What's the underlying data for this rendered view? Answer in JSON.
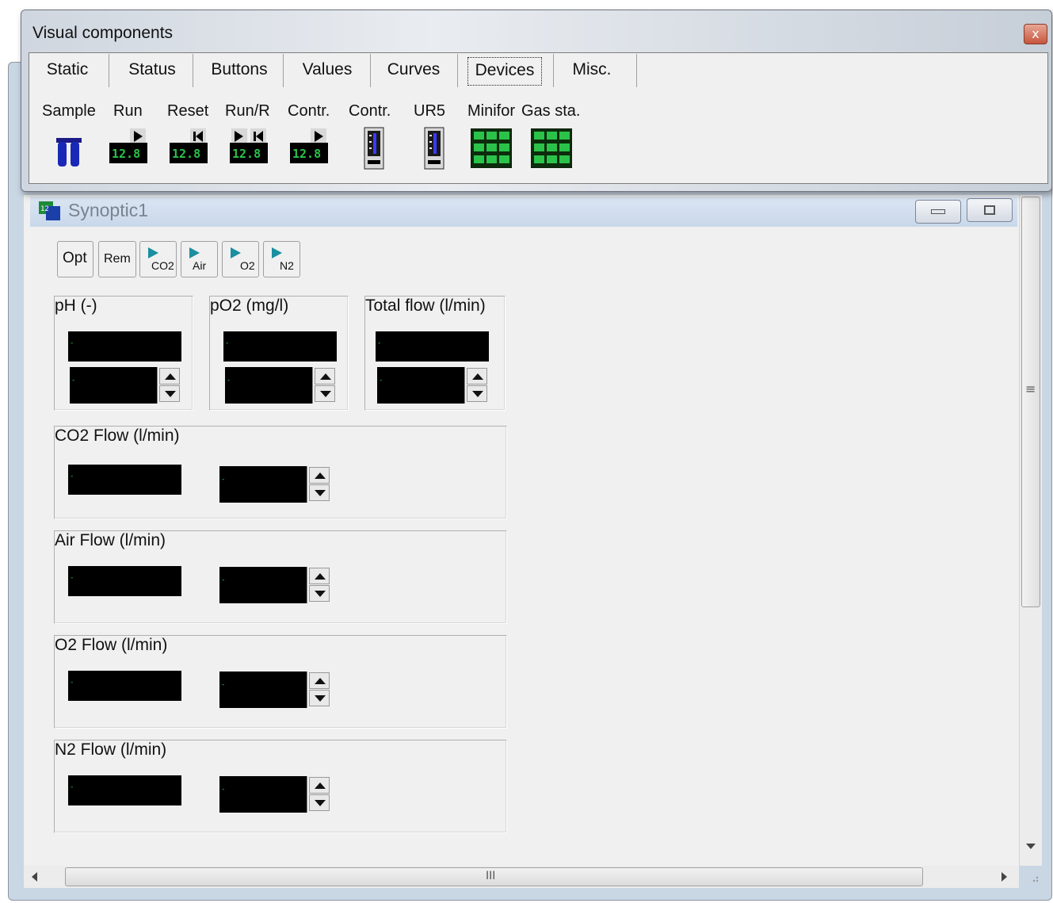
{
  "visual_components": {
    "title": "Visual components",
    "close_label": "x",
    "tabs": [
      "Static",
      "Status",
      "Buttons",
      "Values",
      "Curves",
      "Devices",
      "Misc."
    ],
    "active_tab": "Devices",
    "palette": [
      {
        "label": "Sample",
        "icon": "sample-tubes-icon"
      },
      {
        "label": "Run",
        "icon": "run-display-icon"
      },
      {
        "label": "Reset",
        "icon": "reset-display-icon"
      },
      {
        "label": "Run/R",
        "icon": "run-reset-display-icon"
      },
      {
        "label": "Contr.",
        "icon": "controller-display-icon"
      },
      {
        "label": "Contr.",
        "icon": "controller-gauge-icon"
      },
      {
        "label": "UR5",
        "icon": "ur5-gauge-icon"
      },
      {
        "label": "Minifor",
        "icon": "minifor-grid-icon"
      },
      {
        "label": "Gas sta.",
        "icon": "gas-station-grid-icon"
      }
    ],
    "display_digits": "12.8"
  },
  "synoptic": {
    "title": "Synoptic1",
    "toolbar": [
      {
        "label": "Opt",
        "icon": null
      },
      {
        "label": "Rem",
        "icon": null
      },
      {
        "label": "CO2",
        "icon": "play-icon"
      },
      {
        "label": "Air",
        "icon": "play-icon"
      },
      {
        "label": "O2",
        "icon": "play-icon"
      },
      {
        "label": "N2",
        "icon": "play-icon"
      }
    ],
    "measurements": [
      {
        "label": "pH (-)",
        "display": "-",
        "setpoint": "-"
      },
      {
        "label": "pO2 (mg/l)",
        "display": "-",
        "setpoint": "-"
      },
      {
        "label": "Total flow (l/min)",
        "display": "-",
        "setpoint": "-"
      }
    ],
    "flows": [
      {
        "label": "CO2 Flow (l/min)",
        "display": "-",
        "setpoint": "-"
      },
      {
        "label": "Air Flow (l/min)",
        "display": "-",
        "setpoint": "-"
      },
      {
        "label": "O2 Flow (l/min)",
        "display": "-",
        "setpoint": "-"
      },
      {
        "label": "N2 Flow (l/min)",
        "display": "-",
        "setpoint": "-"
      }
    ],
    "hscroll_grip": "III",
    "vscroll_grip": "≡"
  },
  "colors": {
    "display_bg": "#000000",
    "display_text": "#2bd54c",
    "play_icon": "#1a8fa0"
  }
}
